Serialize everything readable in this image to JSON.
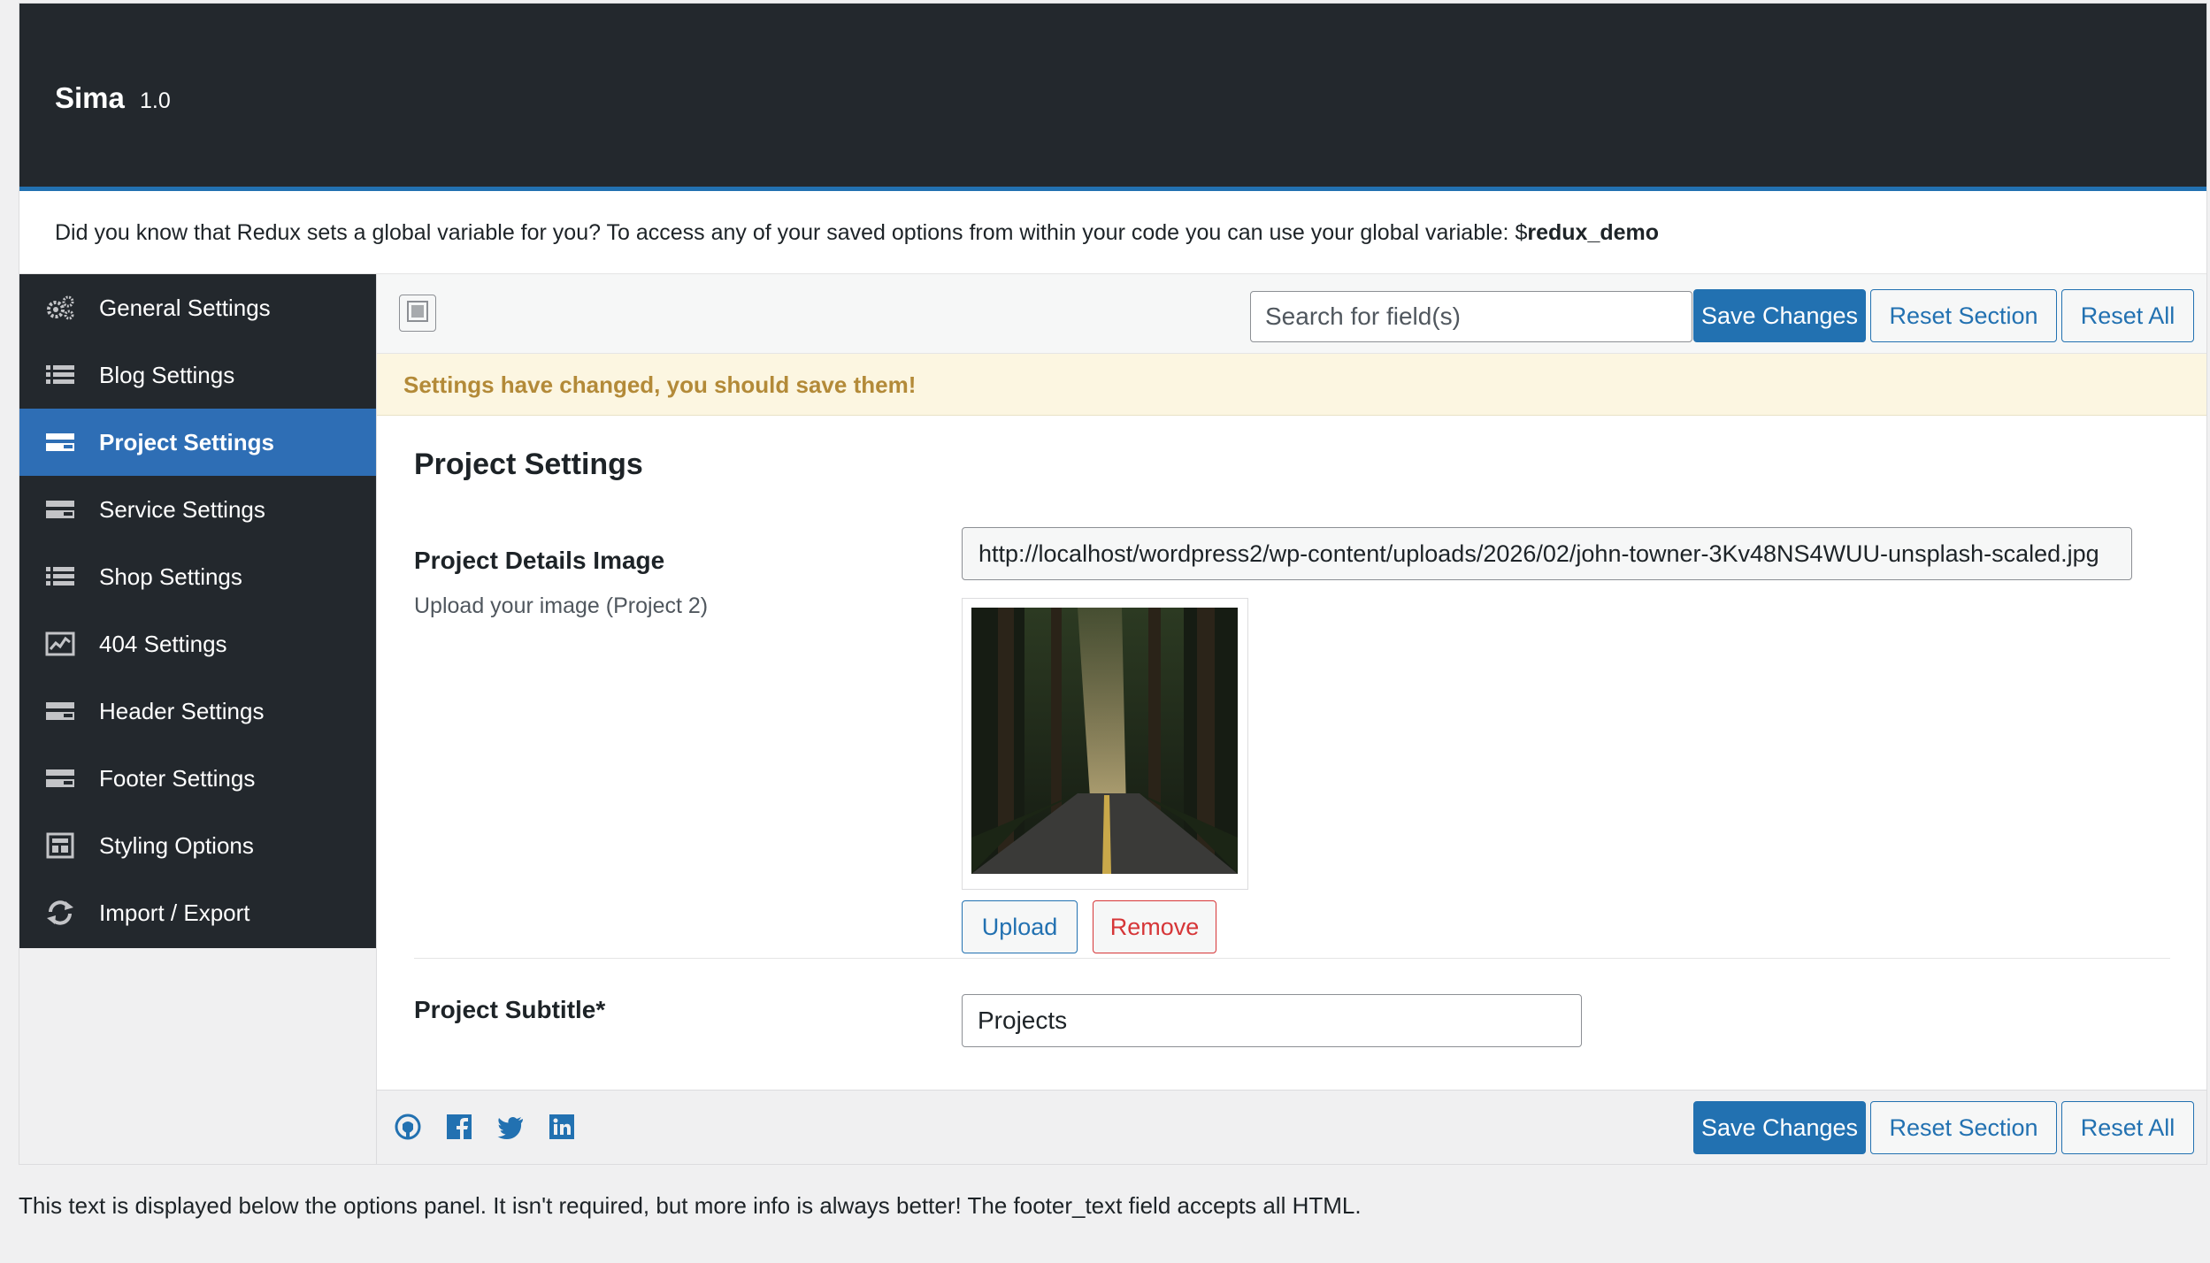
{
  "header": {
    "title": "Sima",
    "version": "1.0"
  },
  "info": {
    "text": "Did you know that Redux sets a global variable for you? To access any of your saved options from within your code you can use your global variable: $",
    "variable": "redux_demo"
  },
  "sidebar": {
    "items": [
      {
        "label": "General Settings",
        "icon": "cogs-icon"
      },
      {
        "label": "Blog Settings",
        "icon": "list-icon"
      },
      {
        "label": "Project Settings",
        "icon": "card-icon",
        "active": true
      },
      {
        "label": "Service Settings",
        "icon": "card-icon"
      },
      {
        "label": "Shop Settings",
        "icon": "list-icon"
      },
      {
        "label": "404 Settings",
        "icon": "chart-icon"
      },
      {
        "label": "Header Settings",
        "icon": "card-icon"
      },
      {
        "label": "Footer Settings",
        "icon": "card-icon"
      },
      {
        "label": "Styling Options",
        "icon": "layout-icon"
      },
      {
        "label": "Import / Export",
        "icon": "refresh-icon"
      }
    ]
  },
  "toolbar": {
    "search_placeholder": "Search for field(s)",
    "save_label": "Save Changes",
    "reset_section_label": "Reset Section",
    "reset_all_label": "Reset All"
  },
  "notice": "Settings have changed, you should save them!",
  "section": {
    "title": "Project Settings",
    "image_field": {
      "label": "Project Details Image",
      "description": "Upload your image (Project 2)",
      "url": "http://localhost/wordpress2/wp-content/uploads/2026/02/john-towner-3Kv48NS4WUU-unsplash-scaled.jpg",
      "upload_label": "Upload",
      "remove_label": "Remove"
    },
    "subtitle_field": {
      "label": "Project Subtitle*",
      "value": "Projects"
    }
  },
  "footer": {
    "social": [
      "github-icon",
      "facebook-icon",
      "twitter-icon",
      "linkedin-icon"
    ],
    "save_label": "Save Changes",
    "reset_section_label": "Reset Section",
    "reset_all_label": "Reset All"
  },
  "below_text": "This text is displayed below the options panel. It isn't required, but more info is always better! The footer_text field accepts all HTML.",
  "colors": {
    "accent": "#2271b1",
    "sidebar_bg": "#23282d",
    "active_item": "#2e6eb5",
    "notice_bg": "#fcf6e1",
    "notice_text": "#b38a38",
    "remove": "#d63638"
  }
}
